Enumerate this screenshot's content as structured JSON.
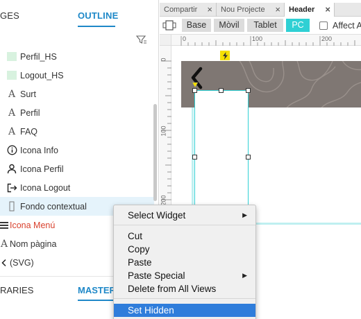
{
  "left_panel": {
    "tabs": {
      "pages": "GES",
      "outline": "OUTLINE"
    },
    "outline_items": [
      {
        "label": "Perfil_HS",
        "icon": "image-thumbnail"
      },
      {
        "label": "Logout_HS",
        "icon": "image-thumbnail"
      },
      {
        "label": "Surt",
        "icon": "text-icon"
      },
      {
        "label": "Perfil",
        "icon": "text-icon"
      },
      {
        "label": "FAQ",
        "icon": "text-icon"
      },
      {
        "label": "Icona Info",
        "icon": "info-icon"
      },
      {
        "label": "Icona Perfil",
        "icon": "user-icon"
      },
      {
        "label": "Icona Logout",
        "icon": "logout-icon"
      },
      {
        "label": "Fondo contextual",
        "icon": "rectangle-icon"
      },
      {
        "label": "Icona Menú",
        "icon": "hamburger-icon"
      },
      {
        "label": "Nom pàgina",
        "icon": "text-icon"
      },
      {
        "label": "(SVG)",
        "icon": "chevron-left-icon"
      }
    ],
    "bottom_tabs": {
      "libraries": "RARIES",
      "masters": "MASTERS"
    }
  },
  "editor": {
    "page_tabs": [
      {
        "label": "Compartir"
      },
      {
        "label": "Nou Projecte"
      },
      {
        "label": "Header"
      }
    ],
    "views": [
      "Base",
      "Mòvil",
      "Tablet",
      "PC"
    ],
    "active_view": "PC",
    "affect_label": "Affect A",
    "ruler_h": [
      "0",
      "100",
      "200"
    ],
    "ruler_v": [
      "0",
      "100",
      "200"
    ]
  },
  "context_menu": {
    "items": [
      {
        "label": "Select Widget",
        "submenu": true
      },
      {
        "label": "Cut",
        "submenu": false
      },
      {
        "label": "Copy",
        "submenu": false
      },
      {
        "label": "Paste",
        "submenu": false
      },
      {
        "label": "Paste Special",
        "submenu": true
      },
      {
        "label": "Delete from All Views",
        "submenu": false
      },
      {
        "label": "Set Hidden",
        "submenu": false
      }
    ],
    "highlighted": "Set Hidden"
  },
  "colors": {
    "accent": "#1e88c8",
    "selected_view": "#2fd0d4",
    "selection_row": "#e5f3fb",
    "menu_highlight": "#2f7ddb",
    "header_band": "#7f7773",
    "red_item": "#d9412d"
  }
}
